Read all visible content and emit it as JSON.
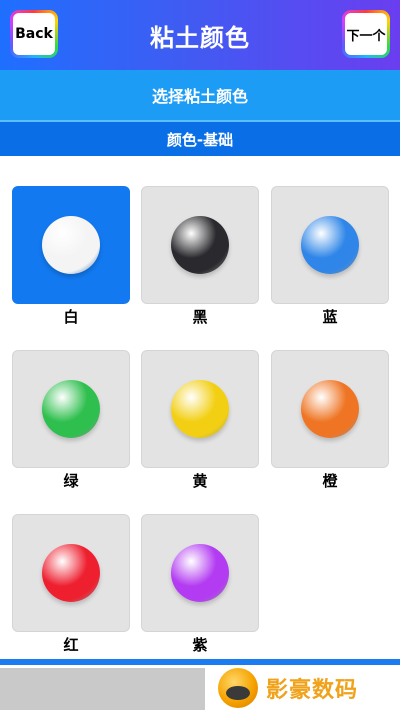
{
  "header": {
    "back_label": "Back",
    "title": "粘土颜色",
    "next_label": "下一个"
  },
  "subtitle": "选择粘土颜色",
  "category": "颜色-基础",
  "colors": [
    {
      "label": "白",
      "hex": "#f4f4f4",
      "selected": true
    },
    {
      "label": "黑",
      "hex": "#2a2a2e",
      "selected": false
    },
    {
      "label": "蓝",
      "hex": "#2f86e8",
      "selected": false
    },
    {
      "label": "绿",
      "hex": "#2fbf4e",
      "selected": false
    },
    {
      "label": "黄",
      "hex": "#f2cf12",
      "selected": false
    },
    {
      "label": "橙",
      "hex": "#ef7524",
      "selected": false
    },
    {
      "label": "红",
      "hex": "#ee2030",
      "selected": false
    },
    {
      "label": "紫",
      "hex": "#b33cf2",
      "selected": false
    }
  ],
  "watermark": {
    "text": "影豪数码",
    "icon": "brand-logo-icon"
  }
}
